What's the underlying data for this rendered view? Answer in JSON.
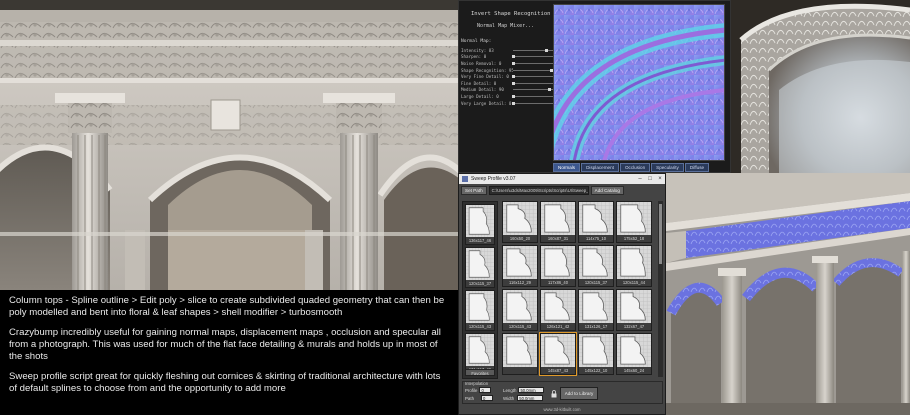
{
  "crazybump": {
    "title": "Invert Shape Recognition",
    "subtitle": "Normal Map Mixer...",
    "section": "Normal Map:",
    "sliders": [
      {
        "label": "Intensity: 83",
        "value": 0.83
      },
      {
        "label": "Sharpen: 0",
        "value": 0.0
      },
      {
        "label": "Noise Removal: 0",
        "value": 0.0
      },
      {
        "label": "Shape Recognition: 95",
        "value": 0.95
      },
      {
        "label": "Very Fine Detail: 0",
        "value": 0.0
      },
      {
        "label": "Fine Detail: 0",
        "value": 0.0
      },
      {
        "label": "Medium Detail: 90",
        "value": 0.9
      },
      {
        "label": "Large Detail: 0",
        "value": 0.0
      },
      {
        "label": "Very Large Detail: 0",
        "value": 0.0
      }
    ],
    "tabs": [
      "Normals",
      "Displacement",
      "Occlusion",
      "Specularity",
      "Diffuse"
    ],
    "active_tab": "Normals"
  },
  "sweep": {
    "title": "Sweep Profile v3.07",
    "set_path_label": "Set Path",
    "path_value": "C:\\Users\\u3ds\\Max2009\\Scripts\\Scripts\\UI\\Sweep_Profile",
    "add_catalog_label": "Add Catalog",
    "side_thumbs": [
      "136x117_46",
      "120x115_37",
      "120x115_43",
      "131x117_46"
    ],
    "favorites_label": "Favorites",
    "grid": [
      "160x50_20",
      "160x87_31",
      "114x75_10",
      "175x52_18",
      "116x112_29",
      "117x86_40",
      "120x115_37",
      "120x115_44",
      "120x115_43",
      "126x121_42",
      "131x126_17",
      "132x67_47",
      "",
      "145x87_43",
      "145x122_10",
      "145x60_24"
    ],
    "selected_index": 13,
    "interp_label": "Interpolation",
    "profile_label": "Profile",
    "profile_value": "0",
    "path_label": "Path",
    "path_steps": "0",
    "length_label": "Length",
    "length_value": "50.0mm",
    "width_label": "Width",
    "width_value": "50.0mm",
    "add_library_label": "Add to Library",
    "footer": "www.3d-kitbuilt.com"
  },
  "caption": {
    "p1": "Column tops - Spline outline > Edit poly > slice to create subdivided quaded geometry that can then be poly modelled  and bent into floral & leaf shapes > shell modifier > turbosmooth",
    "p2": "Crazybump incredibly useful for gaining normal maps, displacement maps , occlusion and specular all from a photograph. This was used for much of the flat face detailing & murals and holds up in most of the shots",
    "p3": "Sweep profile script great for quickly fleshing out cornices & skirting of traditional architecture with lots of default splines to choose from and the opportunity to add more"
  },
  "colors": {
    "caption_bg": "#000000",
    "caption_text": "#eaeaea",
    "normal_map_blue": "#7a7fe8",
    "stone": "#c9c4bc",
    "selection_orange": "#e09a2a"
  }
}
